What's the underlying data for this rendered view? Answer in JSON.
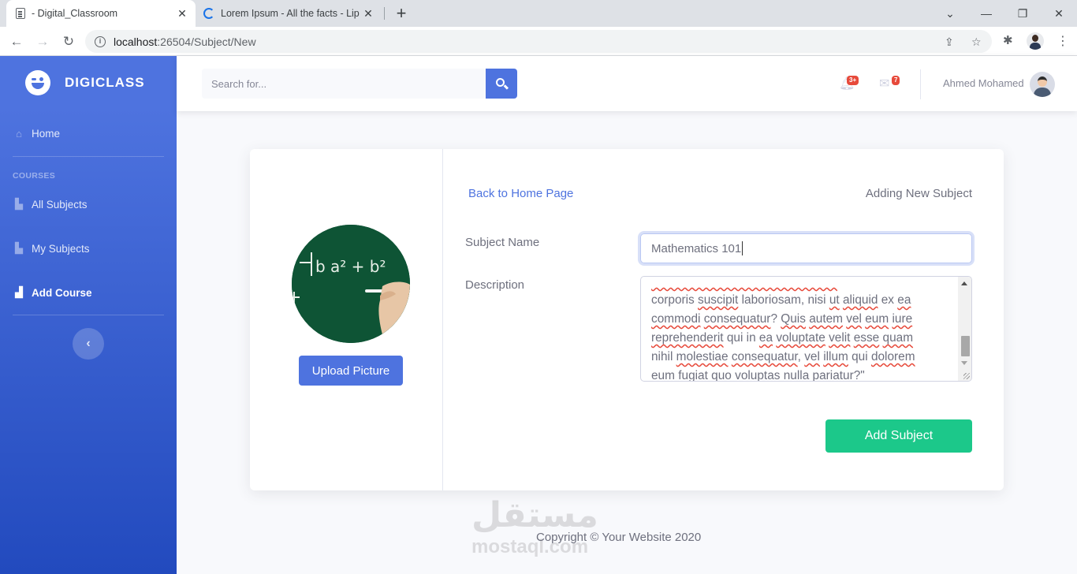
{
  "browser": {
    "tabs": [
      {
        "title": "- Digital_Classroom",
        "close": "✕"
      },
      {
        "title": "Lorem Ipsum - All the facts - Lipsum",
        "close": "✕"
      }
    ],
    "new_tab": "+",
    "window_controls": {
      "minimize": "—",
      "maximize": "❐",
      "close": "✕"
    },
    "chevron": "⌄",
    "url_host": "localhost",
    "url_rest": ":26504/Subject/New",
    "info_glyph": "i"
  },
  "sidebar": {
    "brand": "DIGICLASS",
    "home": "Home",
    "heading": "COURSES",
    "items": [
      {
        "label": "All Subjects",
        "icon": "folder-icon"
      },
      {
        "label": "My Subjects",
        "icon": "folder-icon"
      },
      {
        "label": "Add Course",
        "icon": "briefcase-icon"
      }
    ],
    "toggle": "‹"
  },
  "topbar": {
    "search_placeholder": "Search for...",
    "alerts_badge": "3+",
    "messages_badge": "7",
    "user_name": "Ahmed Mohamed"
  },
  "form": {
    "back_link": "Back to Home Page",
    "title": "Adding New Subject",
    "upload_button": "Upload Picture",
    "subject_name_label": "Subject Name",
    "subject_name_value": "Mathematics 101",
    "description_label": "Description",
    "submit_button": "Add Subject",
    "board_text": "b  a² + b²"
  },
  "footer": {
    "copyright": "Copyright © Your Website 2020"
  },
  "watermark": {
    "arabic": "مستقل",
    "latin": "mostaql.com"
  },
  "colors": {
    "primary": "#4e73df",
    "success": "#1cc88a",
    "danger": "#e74a3b",
    "text": "#6e707e"
  }
}
